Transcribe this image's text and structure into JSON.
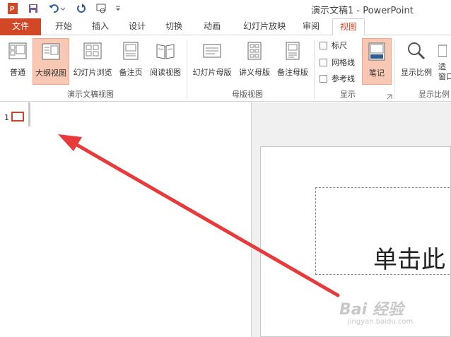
{
  "titlebar": {
    "title": "演示文稿1 - PowerPoint",
    "qat": [
      "app-icon",
      "save-icon",
      "undo-icon",
      "repeat-icon",
      "touch-mode-icon",
      "customize-qat-icon"
    ]
  },
  "tabs": [
    "文件",
    "开始",
    "插入",
    "设计",
    "切换",
    "动画",
    "幻灯片放映",
    "审阅",
    "视图"
  ],
  "ribbon": {
    "presentation_views": {
      "normal": "普通",
      "outline": "大纲视图",
      "sorter": "幻灯片浏览",
      "notes_page": "备注页",
      "reading": "阅读视图",
      "group_label": "演示文稿视图"
    },
    "master_views": {
      "slide_master": "幻灯片母版",
      "handout_master": "讲义母版",
      "notes_master": "备注母版",
      "group_label": "母版视图"
    },
    "show": {
      "ruler": "标尺",
      "gridlines": "网格线",
      "guides": "参考线",
      "notes": "笔记",
      "group_label": "显示"
    },
    "zoom": {
      "zoom": "显示比例",
      "fit_top": "适",
      "fit_bottom": "窗口",
      "group_label": "显示比例"
    }
  },
  "outline": {
    "slide_number": "1"
  },
  "slide": {
    "placeholder_text": "单击此"
  },
  "watermark": {
    "main": "Bai 经验",
    "sub": "jingyan.baidu.com"
  },
  "colors": {
    "accent": "#d24726",
    "selected_bg": "#f8c8b4",
    "arrow": "#e83a3a"
  }
}
